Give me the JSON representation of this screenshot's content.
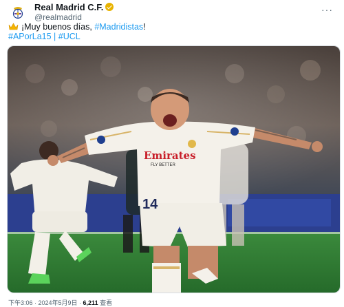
{
  "account": {
    "display_name": "Real Madrid C.F.",
    "handle": "@realmadrid",
    "avatar_icon": "real-madrid-crest-icon",
    "verified_icon": "gold-verified-badge-icon",
    "more_icon": "more-options-icon"
  },
  "tweet": {
    "emoji_icon": "crown-icon",
    "greeting": "¡Muy buenos días, ",
    "greeting_tag": "#Madridistas",
    "greeting_end": "!",
    "hashtag_1": "#APorLa15",
    "separator": " | ",
    "hashtag_2": "#UCL"
  },
  "photo": {
    "shirt_sponsor": "Emirates",
    "shirt_sponsor_sub": "FLY BETTER",
    "shorts_number": "14"
  },
  "meta": {
    "time_date": "下午3:06 · 2024年5月9日 · ",
    "views": "6,211",
    "views_label": " 查看"
  },
  "colors": {
    "link": "#1d9bf0",
    "pitch": "#2f7d32",
    "kit": "#f4f1ea"
  }
}
